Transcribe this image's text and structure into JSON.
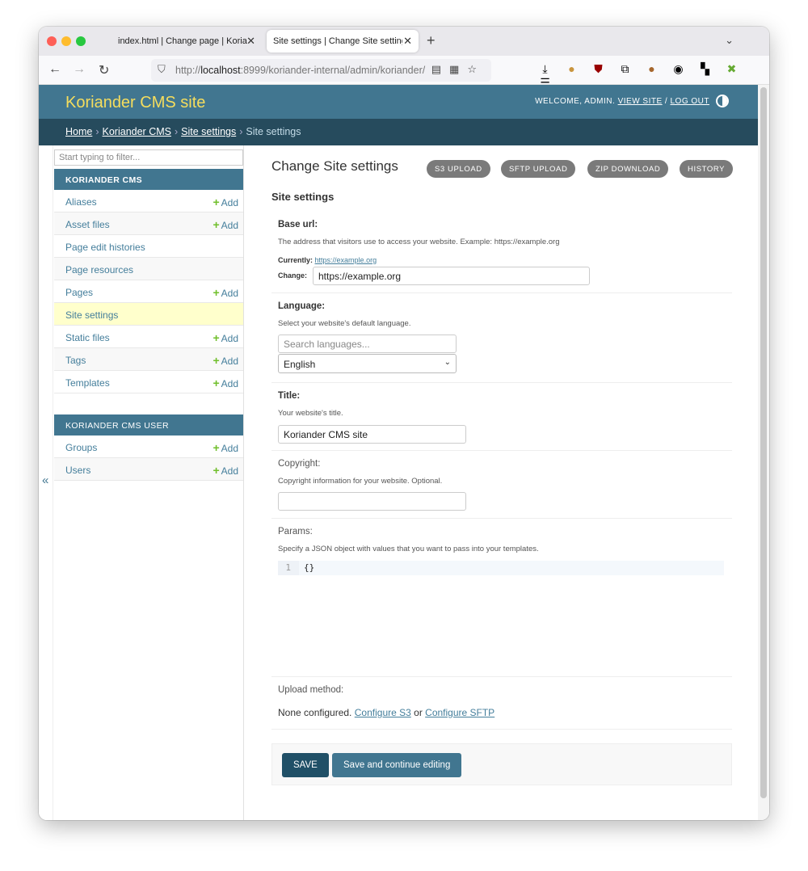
{
  "browser": {
    "tabs": [
      {
        "title": "index.html | Change page | Koriander"
      },
      {
        "title": "Site settings | Change Site settings |"
      }
    ],
    "url": {
      "host": "localhost",
      "prefix": "http://",
      "rest": ":8999/koriander-internal/admin/koriander/"
    }
  },
  "header": {
    "brand": "Koriander CMS site",
    "welcome": "WELCOME, ADMIN.",
    "view_site": "VIEW SITE",
    "divider": "/",
    "logout": "LOG OUT"
  },
  "breadcrumbs": {
    "home": "Home",
    "app": "Koriander CMS",
    "model": "Site settings",
    "current": "Site settings",
    "sep": "›"
  },
  "sidebar": {
    "toggle": "«",
    "filter_placeholder": "Start typing to filter...",
    "add_label": "Add",
    "modules": [
      {
        "caption": "KORIANDER CMS",
        "items": [
          "Aliases",
          "Asset files",
          "Page edit histories",
          "Page resources",
          "Pages",
          "Site settings",
          "Static files",
          "Tags",
          "Templates"
        ]
      },
      {
        "caption": "KORIANDER CMS USER",
        "items": [
          "Groups",
          "Users"
        ]
      }
    ]
  },
  "content": {
    "title": "Change Site settings",
    "object_tools": [
      "S3 UPLOAD",
      "SFTP UPLOAD",
      "ZIP DOWNLOAD",
      "HISTORY"
    ],
    "fieldset_title": "Site settings",
    "base_url": {
      "label": "Base url:",
      "help": "The address that visitors use to access your website. Example: https://example.org",
      "currently_label": "Currently:",
      "currently_value": "https://example.org",
      "change_label": "Change:",
      "value": "https://example.org"
    },
    "language": {
      "label": "Language:",
      "help": "Select your website's default language.",
      "search_placeholder": "Search languages...",
      "selected": "English"
    },
    "title_field": {
      "label": "Title:",
      "help": "Your website's title.",
      "value": "Koriander CMS site"
    },
    "copyright": {
      "label": "Copyright:",
      "help": "Copyright information for your website. Optional.",
      "value": ""
    },
    "params": {
      "label": "Params:",
      "help": "Specify a JSON object with values that you want to pass into your templates.",
      "line_number": "1",
      "code": "{}"
    },
    "upload": {
      "label": "Upload method:",
      "status": "None configured.",
      "configure_s3": "Configure S3",
      "or": "or",
      "configure_sftp": "Configure SFTP"
    },
    "save_label": "SAVE",
    "save_continue_label": "Save and continue editing"
  }
}
